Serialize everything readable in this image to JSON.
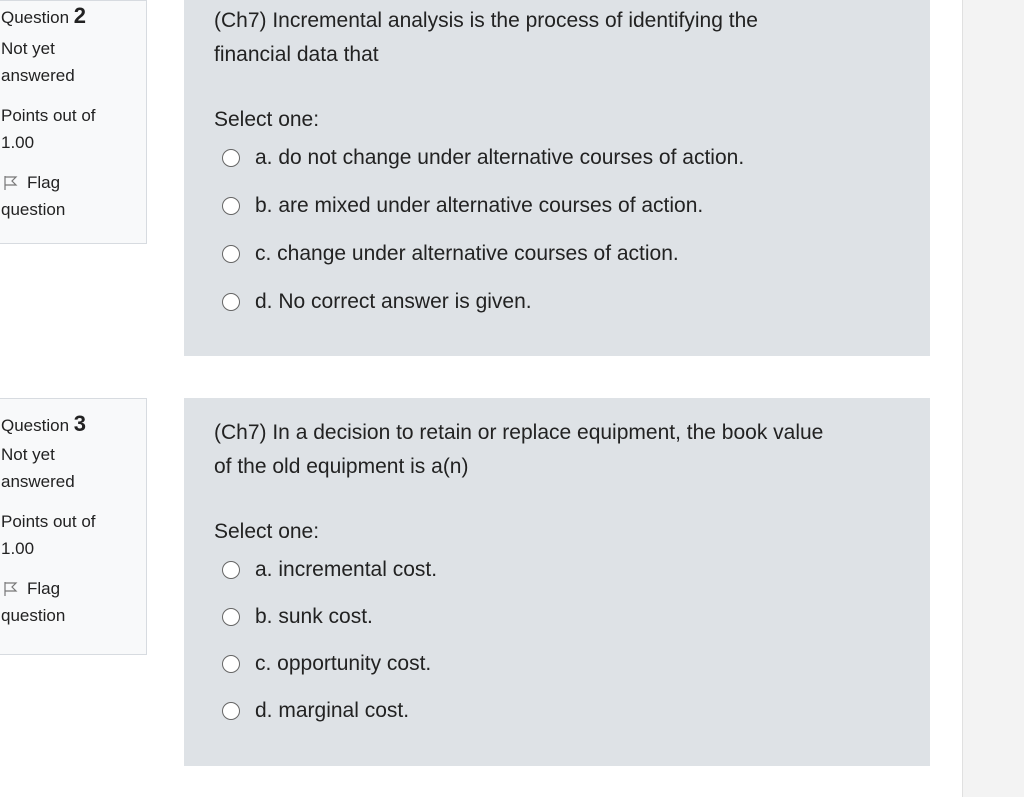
{
  "questions": [
    {
      "label": "Question",
      "number": "2",
      "state_line1": "Not yet",
      "state_line2": "answered",
      "points_line1": "Points out of",
      "points_line2": "1.00",
      "flag_line1": "Flag",
      "flag_line2": "question",
      "prompt_line1": "(Ch7) Incremental analysis is the process of identifying the",
      "prompt_line2": "financial data that",
      "select_label": "Select one:",
      "answers": [
        "a. do not change under alternative courses of action.",
        "b. are mixed under alternative courses of action.",
        "c. change under alternative courses of action.",
        "d. No correct answer is given."
      ]
    },
    {
      "label": "Question",
      "number": "3",
      "state_line1": "Not yet",
      "state_line2": "answered",
      "points_line1": "Points out of",
      "points_line2": "1.00",
      "flag_line1": "Flag",
      "flag_line2": "question",
      "prompt_line1": "(Ch7) In a decision to retain or replace equipment, the book value",
      "prompt_line2": "of the old equipment is a(n)",
      "select_label": "Select one:",
      "answers": [
        "a. incremental cost.",
        "b. sunk cost.",
        "c. opportunity cost.",
        "d. marginal cost."
      ]
    }
  ],
  "icons": {
    "flag": "flag-outline-icon",
    "radio": "radio-unchecked"
  },
  "colors": {
    "info_bg": "#f8f9fa",
    "question_bg": "#dee2e6",
    "text": "#222222"
  }
}
